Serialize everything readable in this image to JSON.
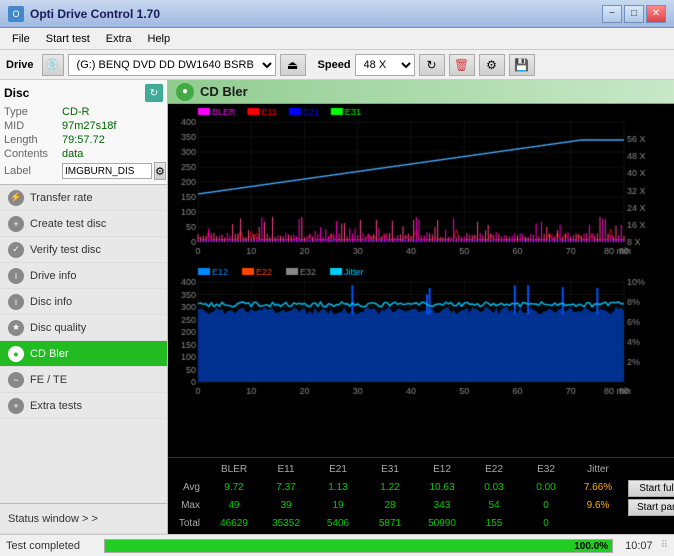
{
  "titleBar": {
    "title": "Opti Drive Control 1.70",
    "minBtn": "−",
    "maxBtn": "□",
    "closeBtn": "✕"
  },
  "menuBar": {
    "items": [
      "File",
      "Start test",
      "Extra",
      "Help"
    ]
  },
  "driveBar": {
    "driveLabel": "Drive",
    "driveValue": "(G:)  BENQ DVD DD DW1640 BSRB",
    "speedLabel": "Speed",
    "speedValue": "48 X"
  },
  "disc": {
    "title": "Disc",
    "typeLabel": "Type",
    "typeValue": "CD-R",
    "midLabel": "MID",
    "midValue": "97m27s18f",
    "lengthLabel": "Length",
    "lengthValue": "79:57.72",
    "contentsLabel": "Contents",
    "contentsValue": "data",
    "labelLabel": "Label",
    "labelValue": "IMGBURN_DIS"
  },
  "navItems": [
    {
      "label": "Transfer rate",
      "active": false
    },
    {
      "label": "Create test disc",
      "active": false
    },
    {
      "label": "Verify test disc",
      "active": false
    },
    {
      "label": "Drive info",
      "active": false
    },
    {
      "label": "Disc info",
      "active": false
    },
    {
      "label": "Disc quality",
      "active": false
    },
    {
      "label": "CD Bler",
      "active": true
    },
    {
      "label": "FE / TE",
      "active": false
    },
    {
      "label": "Extra tests",
      "active": false
    }
  ],
  "statusWindowLabel": "Status window > >",
  "blerTitle": "CD Bler",
  "upperChart": {
    "legend": [
      {
        "label": "BLER",
        "color": "#ff00ff"
      },
      {
        "label": "E11",
        "color": "#ff0000"
      },
      {
        "label": "E21",
        "color": "#0000ff"
      },
      {
        "label": "E31",
        "color": "#00ff00"
      }
    ],
    "yMax": "400",
    "yAxisRight": [
      "56 X",
      "48 X",
      "40 X",
      "32 X",
      "24 X",
      "16 X",
      "8 X"
    ],
    "xMax": "80 min"
  },
  "lowerChart": {
    "legend": [
      {
        "label": "E12",
        "color": "#00aaff"
      },
      {
        "label": "E22",
        "color": "#ff4400"
      },
      {
        "label": "E32",
        "color": "#888888"
      },
      {
        "label": "Jitter",
        "color": "#00ccff"
      }
    ],
    "yMax": "400",
    "yAxisRight": [
      "10%",
      "8%",
      "6%",
      "4%",
      "2%"
    ],
    "xMax": "80 min"
  },
  "statsHeaders": [
    "",
    "BLER",
    "E11",
    "E21",
    "E31",
    "E12",
    "E22",
    "E32",
    "Jitter",
    "",
    ""
  ],
  "statsRows": [
    {
      "label": "Avg",
      "values": [
        "9.72",
        "7.37",
        "1.13",
        "1.22",
        "10.63",
        "0.03",
        "0.00",
        "7.66%"
      ]
    },
    {
      "label": "Max",
      "values": [
        "49",
        "39",
        "19",
        "28",
        "343",
        "54",
        "0",
        "9.6%"
      ]
    },
    {
      "label": "Total",
      "values": [
        "46629",
        "35352",
        "5406",
        "5871",
        "50990",
        "155",
        "0",
        ""
      ]
    }
  ],
  "buttons": {
    "startFull": "Start full",
    "startPart": "Start part"
  },
  "statusBar": {
    "text": "Test completed",
    "progress": 100,
    "progressText": "100.0%",
    "time": "10:07"
  }
}
